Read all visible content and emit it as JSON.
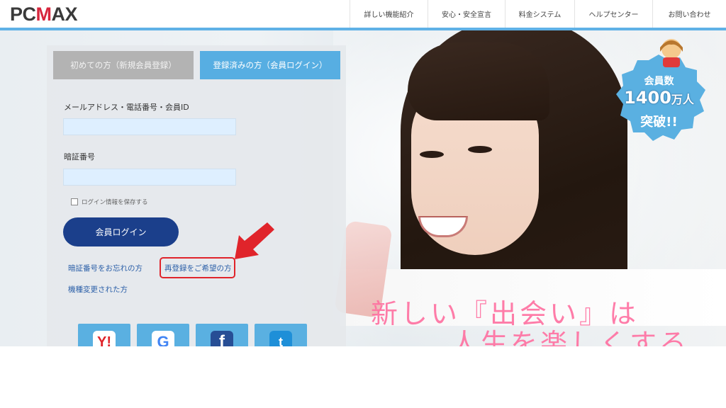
{
  "header": {
    "logo_main": "PC",
    "logo_accent": "M",
    "logo_rest": "AX",
    "nav": [
      "詳しい機能紹介",
      "安心・安全宣言",
      "料金システム",
      "ヘルプセンター",
      "お問い合わせ"
    ]
  },
  "tabs": {
    "new_user": "初めての方（新規会員登録）",
    "login": "登録済みの方（会員ログイン）"
  },
  "form": {
    "id_label": "メールアドレス・電話番号・会員ID",
    "id_value": "",
    "password_label": "暗証番号",
    "password_value": "",
    "remember_label": "ログイン情報を保存する",
    "login_button": "会員ログイン"
  },
  "links": {
    "forgot_password": "暗証番号をお忘れの方",
    "re_register": "再登録をご希望の方",
    "device_changed": "機種変更された方"
  },
  "social": {
    "yahoo_glyph": "Y!",
    "google_glyph": "G",
    "facebook_glyph": "f",
    "twitter_glyph": "t"
  },
  "badge": {
    "line1": "会員数",
    "line2_num": "1400",
    "line2_unit": "万人",
    "line3": "突破!!"
  },
  "tagline": {
    "line1": "新しい『出会い』は",
    "line2": "人生を楽しくする"
  },
  "colors": {
    "header_line": "#5fb1e6",
    "login_tab": "#57aee2",
    "login_button": "#1b3f8b",
    "highlight": "#e0242b",
    "tagline": "#ff6fa0",
    "badge": "#5ab0e1"
  }
}
